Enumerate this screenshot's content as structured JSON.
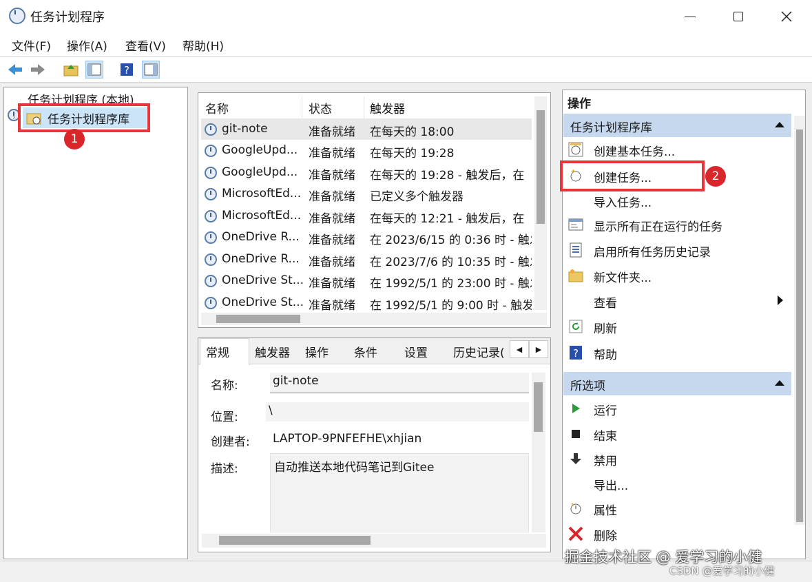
{
  "window": {
    "title": "任务计划程序"
  },
  "menu": [
    "文件(F)",
    "操作(A)",
    "查看(V)",
    "帮助(H)"
  ],
  "tree": {
    "root": "任务计划程序 (本地)",
    "library": "任务计划程序库"
  },
  "annotations": {
    "badge1": "1",
    "badge2": "2"
  },
  "tasks": {
    "columns": [
      "名称",
      "状态",
      "触发器"
    ],
    "rows": [
      {
        "name": "git-note",
        "status": "准备就绪",
        "trigger": "在每天的 18:00"
      },
      {
        "name": "GoogleUpd...",
        "status": "准备就绪",
        "trigger": "在每天的 19:28"
      },
      {
        "name": "GoogleUpd...",
        "status": "准备就绪",
        "trigger": "在每天的 19:28 - 触发后，在"
      },
      {
        "name": "MicrosoftEd...",
        "status": "准备就绪",
        "trigger": "已定义多个触发器"
      },
      {
        "name": "MicrosoftEd...",
        "status": "准备就绪",
        "trigger": "在每天的 12:21 - 触发后，在"
      },
      {
        "name": "OneDrive R...",
        "status": "准备就绪",
        "trigger": "在 2023/6/15 的 0:36 时 - 触发"
      },
      {
        "name": "OneDrive R...",
        "status": "准备就绪",
        "trigger": "在 2023/7/6 的 10:35 时 - 触发"
      },
      {
        "name": "OneDrive St...",
        "status": "准备就绪",
        "trigger": "在 1992/5/1 的 23:00 时 - 触发"
      },
      {
        "name": "OneDrive St...",
        "status": "准备就绪",
        "trigger": "在 1992/5/1 的 9:00 时 - 触发"
      }
    ]
  },
  "detail": {
    "tabs": [
      "常规",
      "触发器",
      "操作",
      "条件",
      "设置",
      "历史记录("
    ],
    "name_label": "名称:",
    "name_value": "git-note",
    "location_label": "位置:",
    "location_value": "\\",
    "author_label": "创建者:",
    "author_value": "LAPTOP-9PNFEFHE\\xhjian",
    "desc_label": "描述:",
    "desc_value": "自动推送本地代码笔记到Gitee"
  },
  "actions": {
    "title": "操作",
    "section1": "任务计划程序库",
    "items1": [
      "创建基本任务...",
      "创建任务...",
      "导入任务...",
      "显示所有正在运行的任务",
      "启用所有任务历史记录",
      "新文件夹...",
      "查看",
      "刷新",
      "帮助"
    ],
    "section2": "所选项",
    "items2": [
      "运行",
      "结束",
      "禁用",
      "导出...",
      "属性",
      "删除"
    ]
  },
  "watermark": {
    "line1": "掘金技术社区 @ 爱学习的小健",
    "line2": "CSDN @爱学习的小健"
  }
}
